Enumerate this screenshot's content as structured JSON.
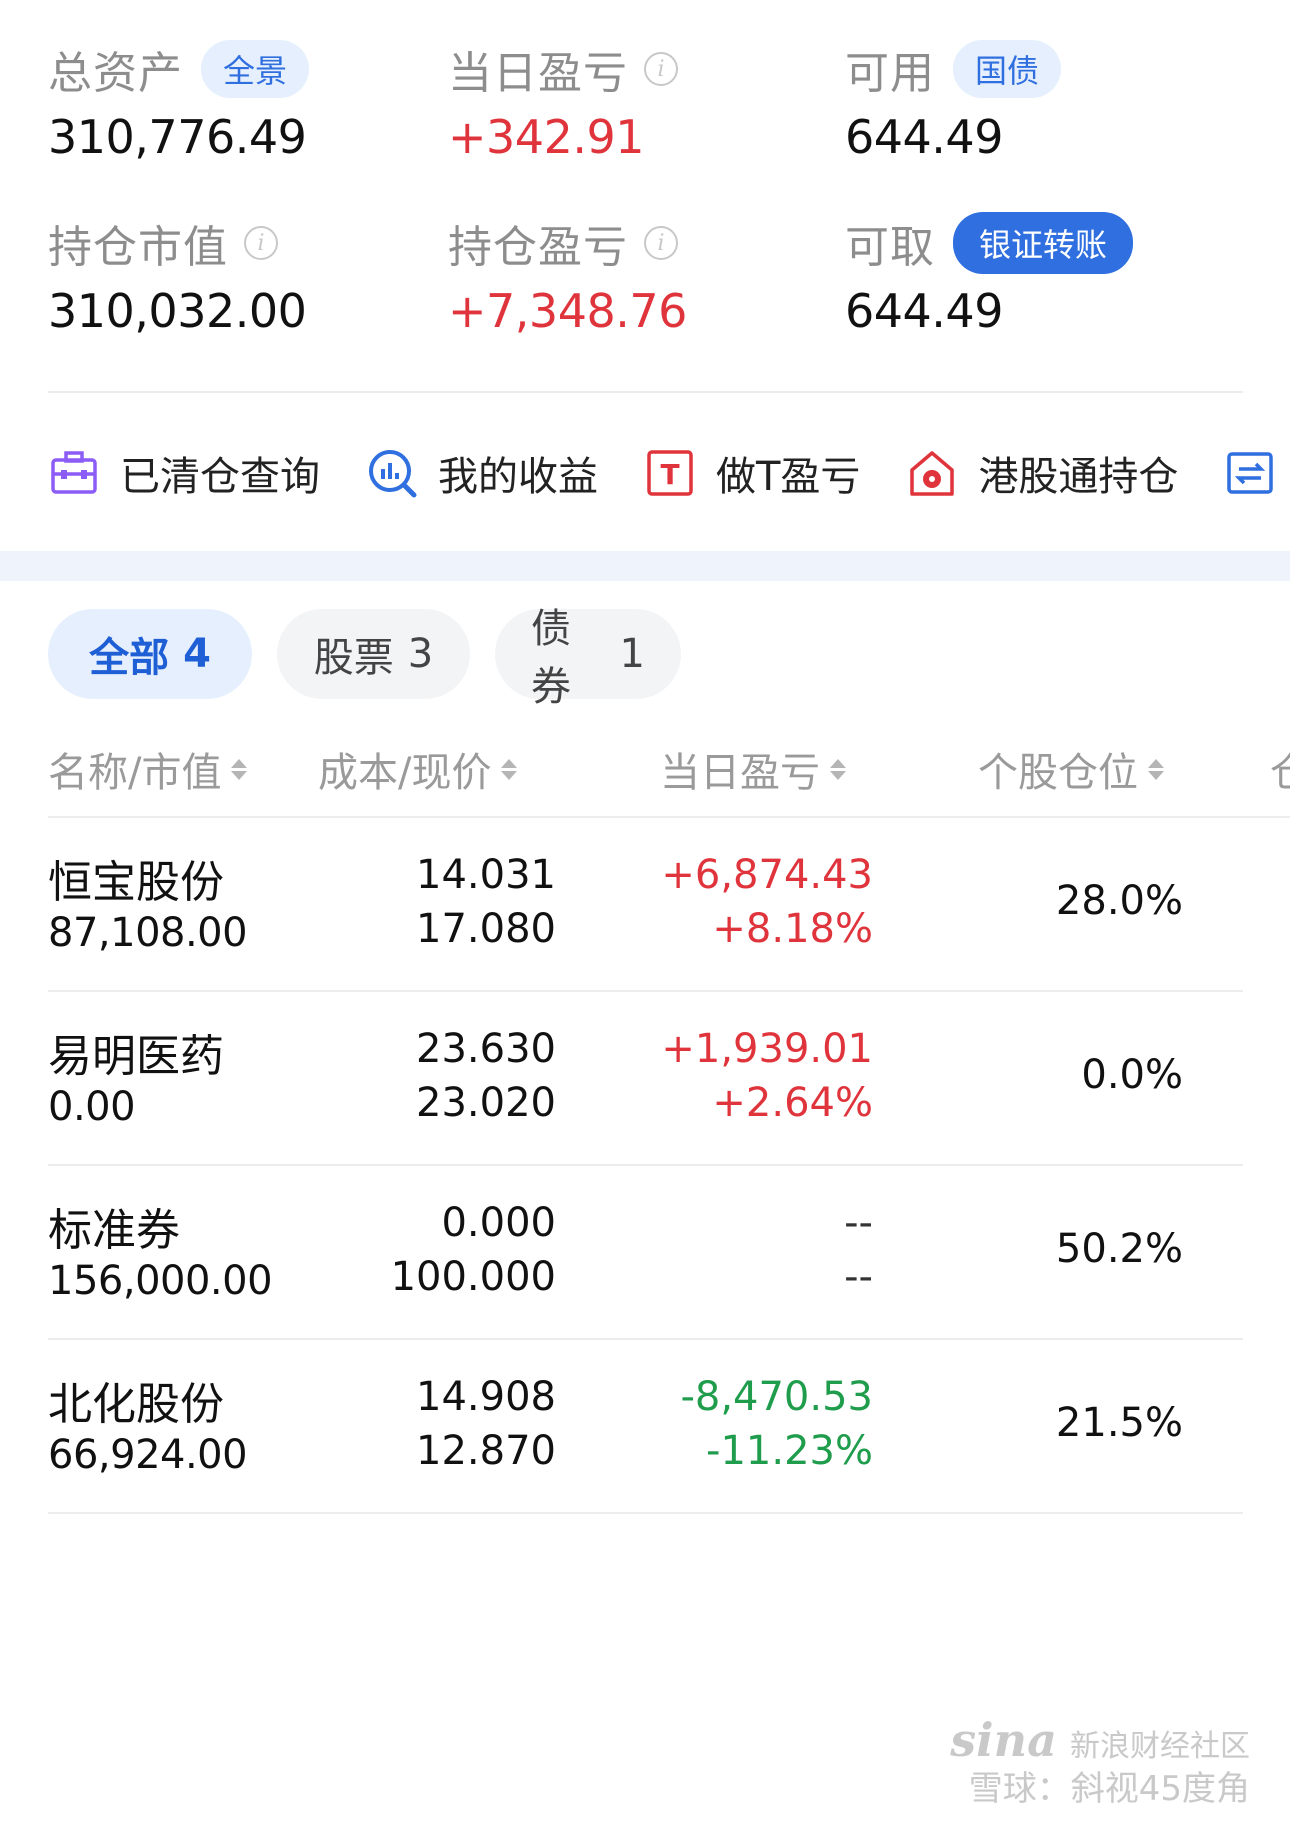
{
  "summary": {
    "total_assets": {
      "label": "总资产",
      "badge": "全景",
      "value": "310,776.49"
    },
    "daily_pl": {
      "label": "当日盈亏",
      "value": "+342.91"
    },
    "available": {
      "label": "可用",
      "badge": "国债",
      "value": "644.49"
    },
    "market_value": {
      "label": "持仓市值",
      "value": "310,032.00"
    },
    "position_pl": {
      "label": "持仓盈亏",
      "value": "+7,348.76"
    },
    "withdrawable": {
      "label": "可取",
      "badge": "银证转账",
      "value": "644.49"
    }
  },
  "quick_links": [
    {
      "label": "已清仓查询",
      "icon": "briefcase-icon",
      "color": "#8b5cf6"
    },
    {
      "label": "我的收益",
      "icon": "chart-search-icon",
      "color": "#2f6fe0"
    },
    {
      "label": "做T盈亏",
      "icon": "t-box-icon",
      "color": "#e0343c"
    },
    {
      "label": "港股通持仓",
      "icon": "hk-house-icon",
      "color": "#e0343c"
    },
    {
      "label": "",
      "icon": "transfer-icon",
      "color": "#2f6fe0"
    }
  ],
  "tabs": [
    {
      "label": "全部",
      "count": "4",
      "active": true
    },
    {
      "label": "股票",
      "count": "3",
      "active": false
    },
    {
      "label": "债券",
      "count": "1",
      "active": false
    }
  ],
  "table": {
    "headers": [
      "名称/市值",
      "成本/现价",
      "当日盈亏",
      "个股仓位",
      "仓"
    ],
    "rows": [
      {
        "name": "恒宝股份",
        "market_value": "87,108.00",
        "cost": "14.031",
        "price": "17.080",
        "pl": "+6,874.43",
        "pl_pct": "+8.18%",
        "position": "28.0%",
        "trend": "up"
      },
      {
        "name": "易明医药",
        "market_value": "0.00",
        "cost": "23.630",
        "price": "23.020",
        "pl": "+1,939.01",
        "pl_pct": "+2.64%",
        "position": "0.0%",
        "trend": "up"
      },
      {
        "name": "标准券",
        "market_value": "156,000.00",
        "cost": "0.000",
        "price": "100.000",
        "pl": "--",
        "pl_pct": "--",
        "position": "50.2%",
        "trend": "none"
      },
      {
        "name": "北化股份",
        "market_value": "66,924.00",
        "cost": "14.908",
        "price": "12.870",
        "pl": "-8,470.53",
        "pl_pct": "-11.23%",
        "position": "21.5%",
        "trend": "down"
      }
    ]
  },
  "watermark": {
    "brand": "sina",
    "forum": "新浪财经社区",
    "line2": "雪球：斜视45度角"
  },
  "colors": {
    "up": "#e0343c",
    "down": "#1f9d4c",
    "accent": "#2f6fe0"
  }
}
